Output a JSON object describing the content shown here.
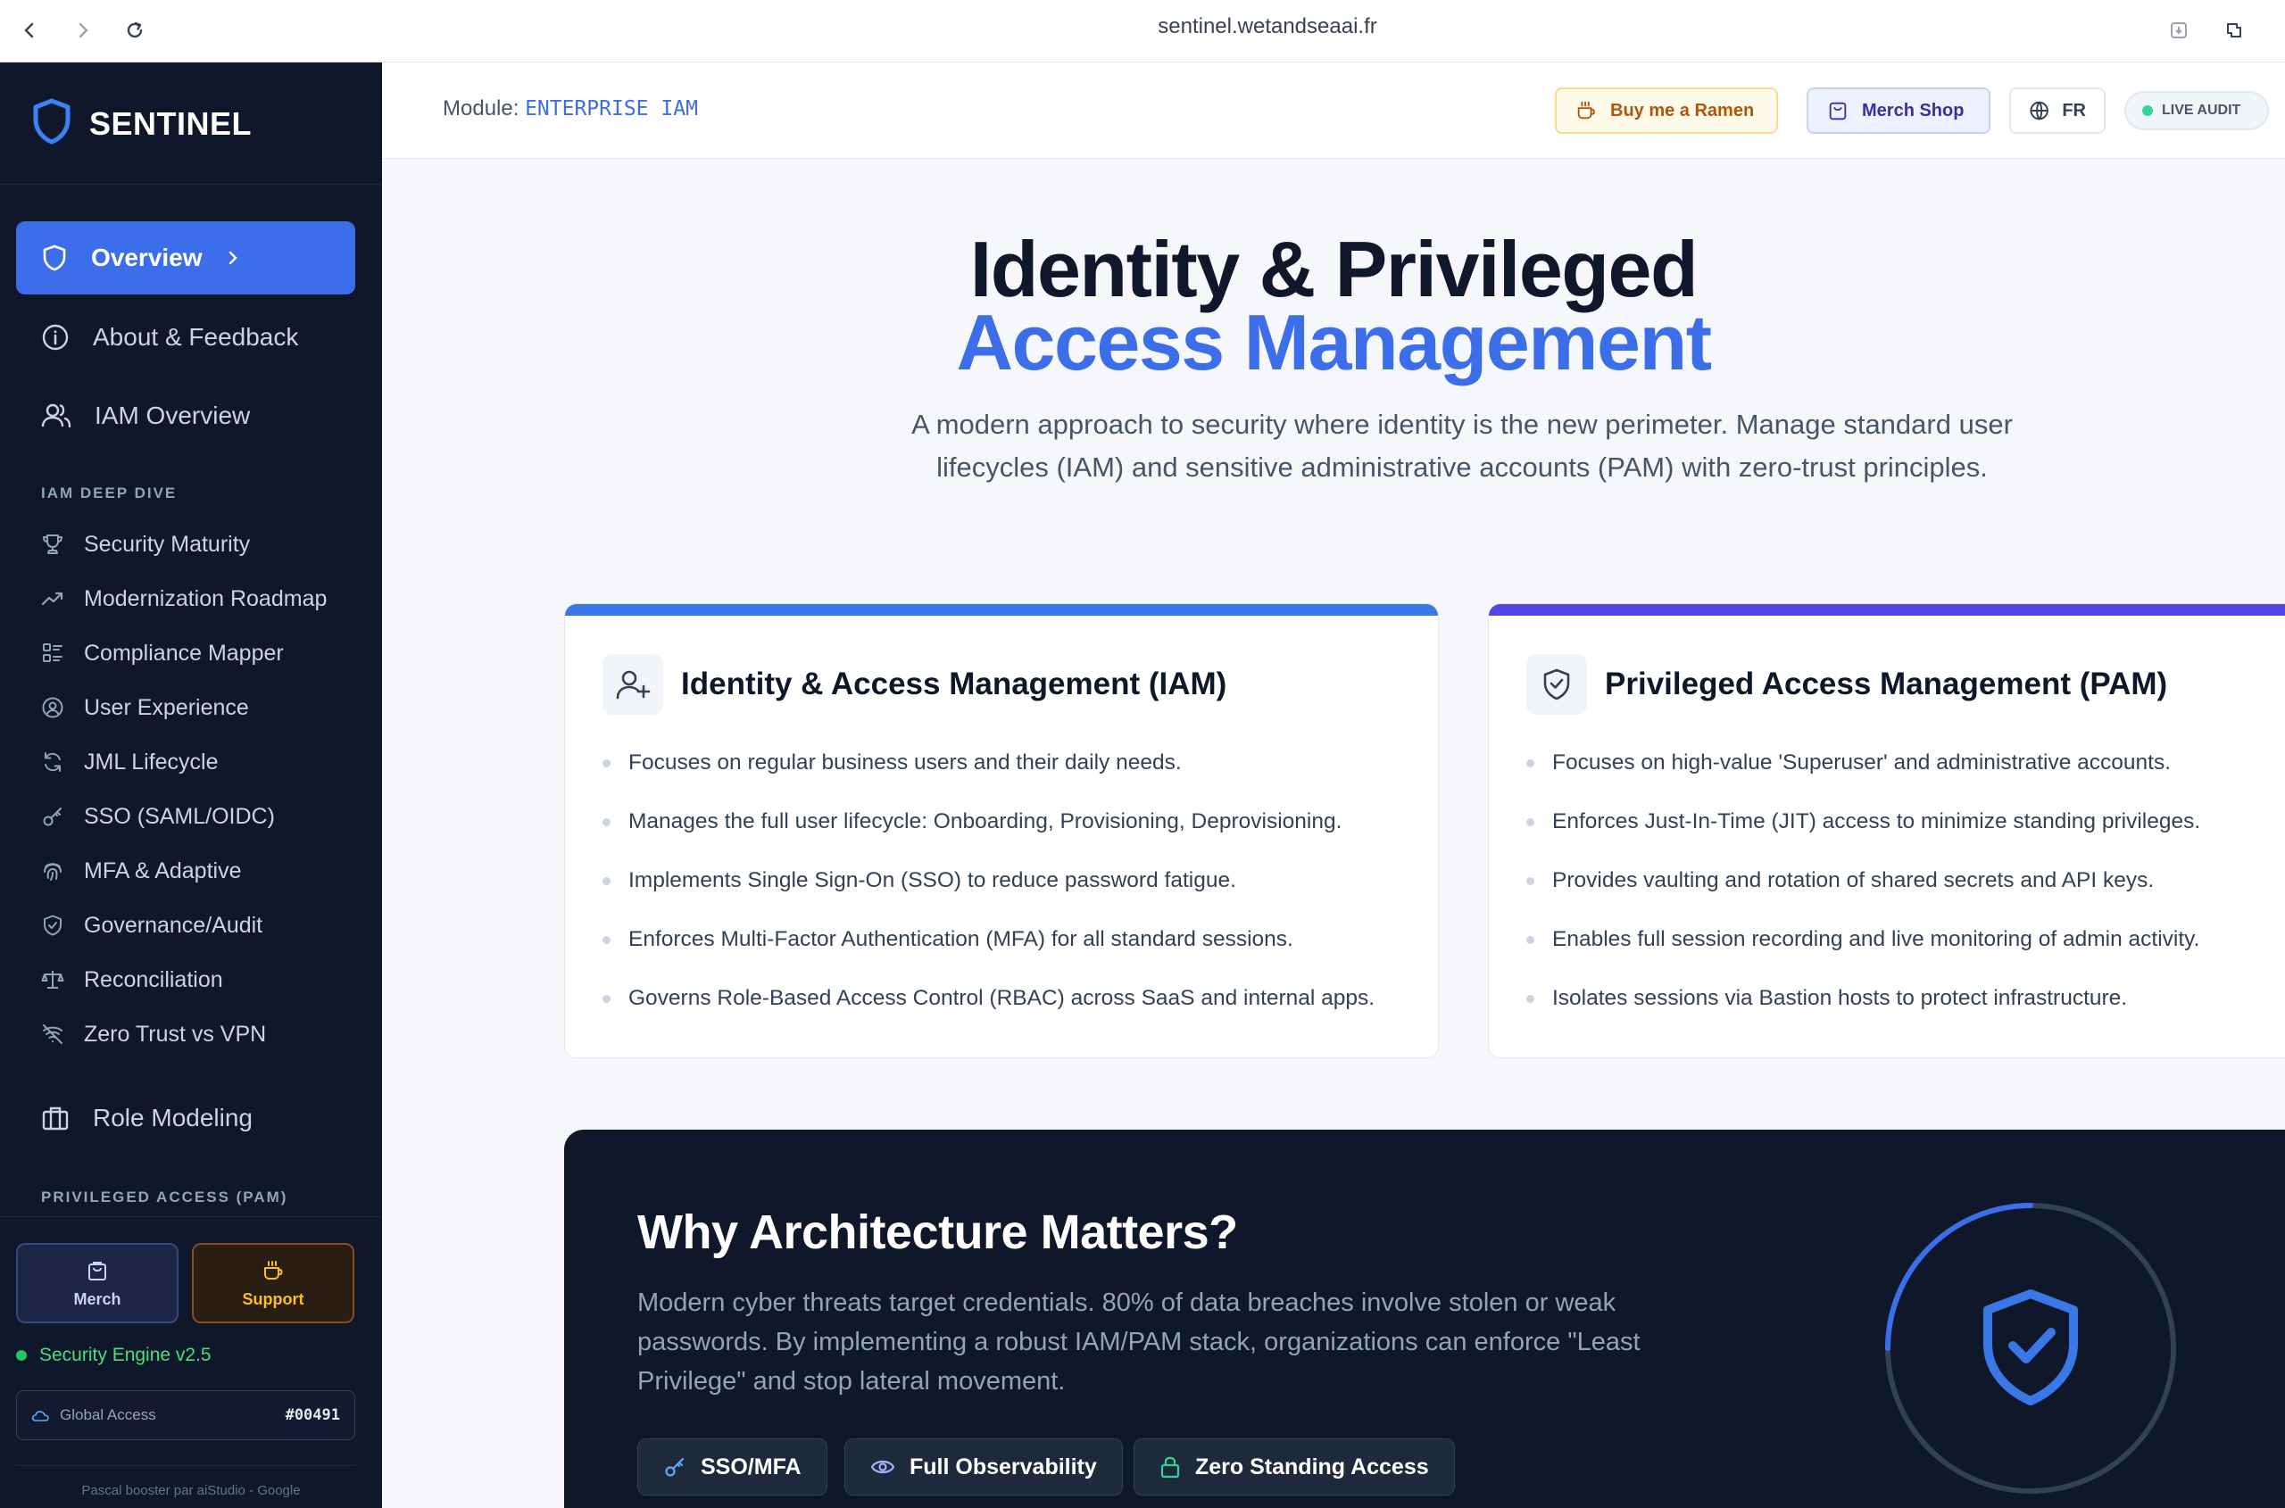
{
  "browser": {
    "url": "sentinel.wetandseaai.fr"
  },
  "brand": {
    "name": "SENTINEL"
  },
  "sidebar": {
    "main_items": [
      {
        "label": "Overview",
        "icon": "shield-icon",
        "active": true
      },
      {
        "label": "About & Feedback",
        "icon": "info-icon"
      },
      {
        "label": "IAM Overview",
        "icon": "users-icon"
      }
    ],
    "section_iam": "IAM DEEP DIVE",
    "iam_items": [
      {
        "label": "Security Maturity",
        "icon": "trophy-icon"
      },
      {
        "label": "Modernization Roadmap",
        "icon": "trending-up-icon"
      },
      {
        "label": "Compliance Mapper",
        "icon": "checklist-icon"
      },
      {
        "label": "User Experience",
        "icon": "user-circle-icon"
      },
      {
        "label": "JML Lifecycle",
        "icon": "refresh-icon"
      },
      {
        "label": "SSO (SAML/OIDC)",
        "icon": "key-icon"
      },
      {
        "label": "MFA & Adaptive",
        "icon": "fingerprint-icon"
      },
      {
        "label": "Governance/Audit",
        "icon": "shield-check-icon"
      },
      {
        "label": "Reconciliation",
        "icon": "scale-icon"
      },
      {
        "label": "Zero Trust vs VPN",
        "icon": "wifi-off-icon"
      }
    ],
    "role_modeling": "Role Modeling",
    "section_pam": "PRIVILEGED ACCESS (PAM)",
    "merch_label": "Merch",
    "support_label": "Support",
    "engine_status": "Security Engine v2.5",
    "global_access_label": "Global Access",
    "global_access_code": "#00491",
    "credit": "Pascal booster par aiStudio - Google"
  },
  "header": {
    "module_label": "Module:",
    "module_value": "ENTERPRISE IAM",
    "ramen_label": "Buy me a Ramen",
    "merch_label": "Merch Shop",
    "lang_label": "FR",
    "live_label": "LIVE AUDIT"
  },
  "hero": {
    "title_line1": "Identity & Privileged",
    "title_line2": "Access Management",
    "subtitle": "A modern approach to security where identity is the new perimeter. Manage standard user lifecycles (IAM) and sensitive administrative accounts (PAM) with zero-trust principles."
  },
  "iam_card": {
    "title": "Identity & Access Management (IAM)",
    "items": [
      "Focuses on regular business users and their daily needs.",
      "Manages the full user lifecycle: Onboarding, Provisioning, Deprovisioning.",
      "Implements Single Sign-On (SSO) to reduce password fatigue.",
      "Enforces Multi-Factor Authentication (MFA) for all standard sessions.",
      "Governs Role-Based Access Control (RBAC) across SaaS and internal apps."
    ]
  },
  "pam_card": {
    "title": "Privileged Access Management (PAM)",
    "items": [
      "Focuses on high-value 'Superuser' and administrative accounts.",
      "Enforces Just-In-Time (JIT) access to minimize standing privileges.",
      "Provides vaulting and rotation of shared secrets and API keys.",
      "Enables full session recording and live monitoring of admin activity.",
      "Isolates sessions via Bastion hosts to protect infrastructure."
    ]
  },
  "architecture": {
    "title": "Why Architecture Matters?",
    "text": "Modern cyber threats target credentials. 80% of data breaches involve stolen or weak passwords. By implementing a robust IAM/PAM stack, organizations can enforce \"Least Privilege\" and stop lateral movement.",
    "pills": [
      "SSO/MFA",
      "Full Observability",
      "Zero Standing Access"
    ]
  },
  "colors": {
    "accent": "#3b6ee8",
    "sidebar_bg": "#0f172a",
    "pam_accent": "#4f46e5"
  }
}
